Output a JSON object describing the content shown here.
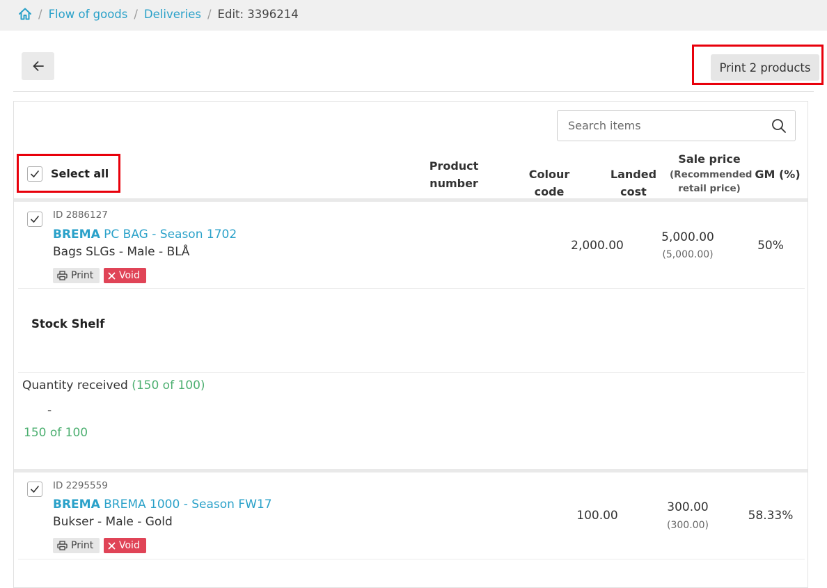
{
  "breadcrumb": {
    "home_icon": "home-icon",
    "items": [
      "Flow of goods",
      "Deliveries"
    ],
    "current": "Edit: 3396214",
    "separator": "/"
  },
  "toolbar": {
    "back_icon": "arrow-left-icon",
    "print_label": "Print 2 products"
  },
  "search": {
    "placeholder": "Search items",
    "value": "",
    "icon": "search-icon"
  },
  "table": {
    "select_all_label": "Select all",
    "select_all_checked": true,
    "columns": {
      "product_number_1": "Product",
      "product_number_2": "number",
      "colour_code": "Colour code",
      "landed_cost": "Landed cost",
      "sale_price": "Sale price",
      "sale_price_sub_1": "(Recommended",
      "sale_price_sub_2": "retail price)",
      "gm": "GM (%)"
    },
    "items": [
      {
        "checked": true,
        "id": "ID 2886127",
        "brand": "BREMA",
        "title": " PC BAG - Season 1702",
        "subtitle": "Bags SLGs - Male - BLÅ",
        "print_label": "Print",
        "void_label": "Void",
        "landed_cost": "2,000.00",
        "sale_price": "5,000.00",
        "retail_price": "(5,000.00)",
        "gm": "50%"
      },
      {
        "checked": true,
        "id": "ID 2295559",
        "brand": "BREMA",
        "title": " BREMA 1000 - Season FW17",
        "subtitle": "Bukser - Male - Gold",
        "print_label": "Print",
        "void_label": "Void",
        "landed_cost": "100.00",
        "sale_price": "300.00",
        "retail_price": "(300.00)",
        "gm": "58.33%"
      }
    ]
  },
  "stock": {
    "shelf_label": "Stock Shelf",
    "qty_label": "Quantity received ",
    "qty_status": "(150 of 100)",
    "dash": "-",
    "qty_value": "150 of 100"
  },
  "colors": {
    "accent": "#2aa1c9",
    "success": "#4caf70",
    "danger": "#e04457",
    "highlight": "#e8000b"
  }
}
